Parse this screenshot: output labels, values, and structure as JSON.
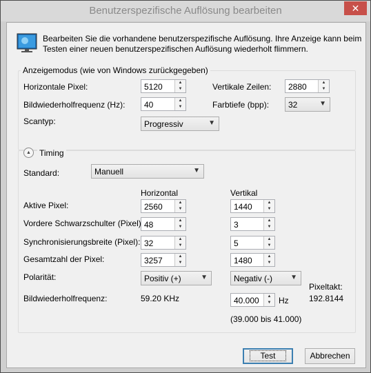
{
  "window": {
    "title": "Benutzerspezifische Auflösung bearbeiten",
    "close_glyph": "✕"
  },
  "intro": {
    "line1": "Bearbeiten Sie die vorhandene benutzerspezifische Auflösung. Ihre Anzeige kann beim",
    "line2": "Testen einer neuen benutzerspezifischen Auflösung wiederholt flimmern."
  },
  "display_mode": {
    "legend": "Anzeigemodus (wie von Windows zurückgegeben)",
    "horizontal_pixels": {
      "label": "Horizontale Pixel:",
      "value": "5120"
    },
    "vertical_lines": {
      "label": "Vertikale Zeilen:",
      "value": "2880"
    },
    "refresh_rate": {
      "label": "Bildwiederholfrequenz (Hz):",
      "value": "40"
    },
    "color_depth": {
      "label": "Farbtiefe (bpp):",
      "value": "32"
    },
    "scan_type": {
      "label": "Scantyp:",
      "value": "Progressiv"
    }
  },
  "timing": {
    "legend": "Timing",
    "standard": {
      "label": "Standard:",
      "value": "Manuell"
    },
    "col_horizontal": "Horizontal",
    "col_vertical": "Vertikal",
    "active_pixels": {
      "label": "Aktive Pixel:",
      "h": "2560",
      "v": "1440"
    },
    "front_porch": {
      "label": "Vordere Schwarzschulter (Pixel):",
      "h": "48",
      "v": "3"
    },
    "sync_width": {
      "label": "Synchronisierungsbreite (Pixel):",
      "h": "32",
      "v": "5"
    },
    "total_pixels": {
      "label": "Gesamtzahl der Pixel:",
      "h": "3257",
      "v": "1480"
    },
    "polarity": {
      "label": "Polarität:",
      "h": "Positiv (+)",
      "v": "Negativ (-)"
    },
    "refresh": {
      "label": "Bildwiederholfrequenz:",
      "h_value": "59.20 KHz",
      "v_value": "40.000",
      "unit": "Hz",
      "range": "(39.000 bis 41.000)"
    },
    "pixel_clock": {
      "label": "Pixeltakt:",
      "value": "192.8144"
    }
  },
  "buttons": {
    "test": "Test",
    "cancel": "Abbrechen"
  },
  "glyphs": {
    "up": "▲",
    "down": "▼",
    "dropdown": "⌄",
    "collapse": "▲"
  }
}
